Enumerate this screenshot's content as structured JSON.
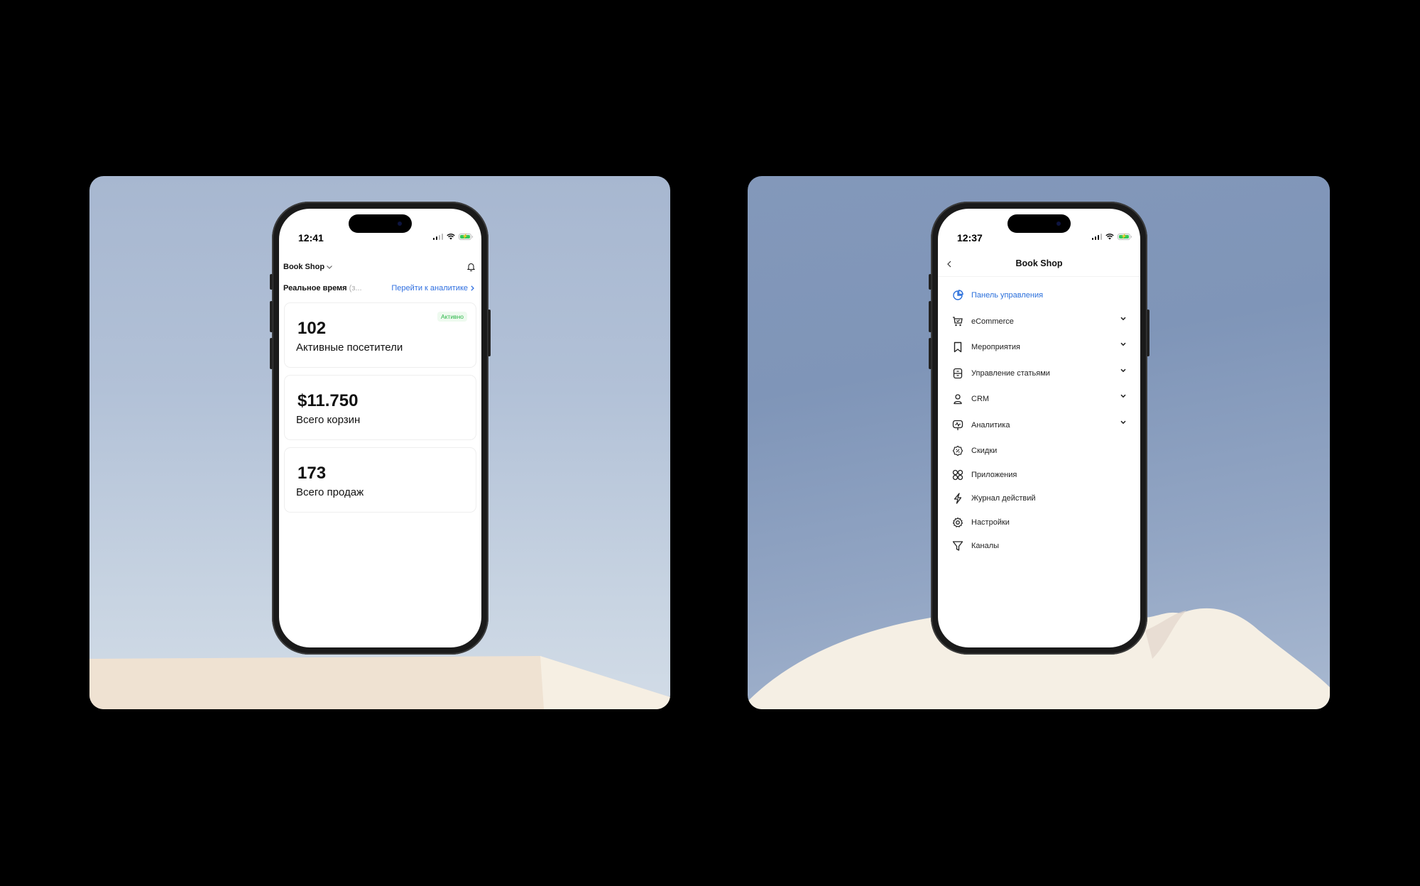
{
  "left_phone": {
    "status": {
      "time": "12:41",
      "battery_charging": true
    },
    "header": {
      "shop_name": "Book Shop",
      "notifications_icon": "bell-icon"
    },
    "realtime": {
      "title": "Реальное время",
      "title_suffix": "(з...",
      "link_label": "Перейти к аналитике"
    },
    "cards": [
      {
        "value": "102",
        "label": "Активные посетители",
        "badge": "Активно"
      },
      {
        "value": "$11.750",
        "label": "Всего корзин"
      },
      {
        "value": "173",
        "label": "Всего продаж"
      }
    ]
  },
  "right_phone": {
    "status": {
      "time": "12:37",
      "battery_charging": true
    },
    "header": {
      "title": "Book Shop",
      "back_icon": "chevron-left-icon"
    },
    "menu": [
      {
        "label": "Панель управления",
        "icon": "pie-chart-icon",
        "active": true,
        "expandable": false
      },
      {
        "label": "eCommerce",
        "icon": "cart-icon",
        "active": false,
        "expandable": true
      },
      {
        "label": "Мероприятия",
        "icon": "bookmark-icon",
        "active": false,
        "expandable": true
      },
      {
        "label": "Управление статьями",
        "icon": "archive-icon",
        "active": false,
        "expandable": true
      },
      {
        "label": "CRM",
        "icon": "user-icon",
        "active": false,
        "expandable": true
      },
      {
        "label": "Аналитика",
        "icon": "presentation-chart-icon",
        "active": false,
        "expandable": true
      },
      {
        "label": "Скидки",
        "icon": "discount-icon",
        "active": false,
        "expandable": false
      },
      {
        "label": "Приложения",
        "icon": "apps-grid-icon",
        "active": false,
        "expandable": false
      },
      {
        "label": "Журнал действий",
        "icon": "lightning-icon",
        "active": false,
        "expandable": false
      },
      {
        "label": "Настройки",
        "icon": "gear-icon",
        "active": false,
        "expandable": false
      },
      {
        "label": "Каналы",
        "icon": "filter-icon",
        "active": false,
        "expandable": false
      }
    ]
  },
  "colors": {
    "accent_blue": "#2a6fdb",
    "active_green": "#2db84a",
    "battery_green": "#34c759"
  }
}
